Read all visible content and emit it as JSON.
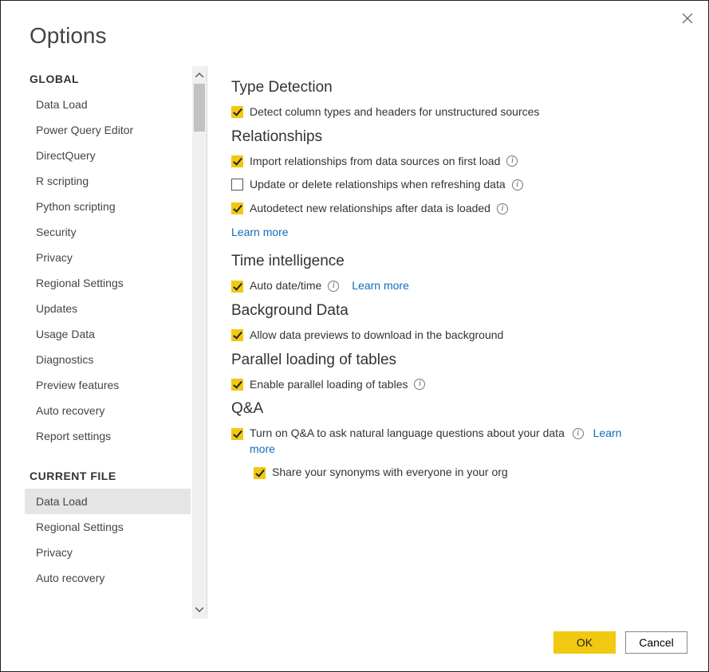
{
  "dialog": {
    "title": "Options"
  },
  "sidebar": {
    "sections": [
      {
        "header": "GLOBAL",
        "items": [
          {
            "label": "Data Load",
            "selected": false
          },
          {
            "label": "Power Query Editor",
            "selected": false
          },
          {
            "label": "DirectQuery",
            "selected": false
          },
          {
            "label": "R scripting",
            "selected": false
          },
          {
            "label": "Python scripting",
            "selected": false
          },
          {
            "label": "Security",
            "selected": false
          },
          {
            "label": "Privacy",
            "selected": false
          },
          {
            "label": "Regional Settings",
            "selected": false
          },
          {
            "label": "Updates",
            "selected": false
          },
          {
            "label": "Usage Data",
            "selected": false
          },
          {
            "label": "Diagnostics",
            "selected": false
          },
          {
            "label": "Preview features",
            "selected": false
          },
          {
            "label": "Auto recovery",
            "selected": false
          },
          {
            "label": "Report settings",
            "selected": false
          }
        ]
      },
      {
        "header": "CURRENT FILE",
        "items": [
          {
            "label": "Data Load",
            "selected": true
          },
          {
            "label": "Regional Settings",
            "selected": false
          },
          {
            "label": "Privacy",
            "selected": false
          },
          {
            "label": "Auto recovery",
            "selected": false
          }
        ]
      }
    ]
  },
  "content": {
    "typeDetection": {
      "heading": "Type Detection",
      "opt1": {
        "label": "Detect column types and headers for unstructured sources",
        "checked": true
      }
    },
    "relationships": {
      "heading": "Relationships",
      "opt1": {
        "label": "Import relationships from data sources on first load",
        "checked": true,
        "info": true
      },
      "opt2": {
        "label": "Update or delete relationships when refreshing data",
        "checked": false,
        "info": true
      },
      "opt3": {
        "label": "Autodetect new relationships after data is loaded",
        "checked": true,
        "info": true
      },
      "learnMore": "Learn more"
    },
    "timeIntelligence": {
      "heading": "Time intelligence",
      "opt1": {
        "label": "Auto date/time",
        "checked": true,
        "info": true
      },
      "learnMore": "Learn more"
    },
    "backgroundData": {
      "heading": "Background Data",
      "opt1": {
        "label": "Allow data previews to download in the background",
        "checked": true
      }
    },
    "parallel": {
      "heading": "Parallel loading of tables",
      "opt1": {
        "label": "Enable parallel loading of tables",
        "checked": true,
        "info": true
      }
    },
    "qna": {
      "heading": "Q&A",
      "opt1": {
        "label": "Turn on Q&A to ask natural language questions about your data",
        "checked": true,
        "info": true
      },
      "learnMore": "Learn more",
      "opt2": {
        "label": "Share your synonyms with everyone in your org",
        "checked": true
      }
    }
  },
  "footer": {
    "ok": "OK",
    "cancel": "Cancel"
  },
  "colors": {
    "accent": "#f2c811",
    "link": "#0f6cbd"
  }
}
